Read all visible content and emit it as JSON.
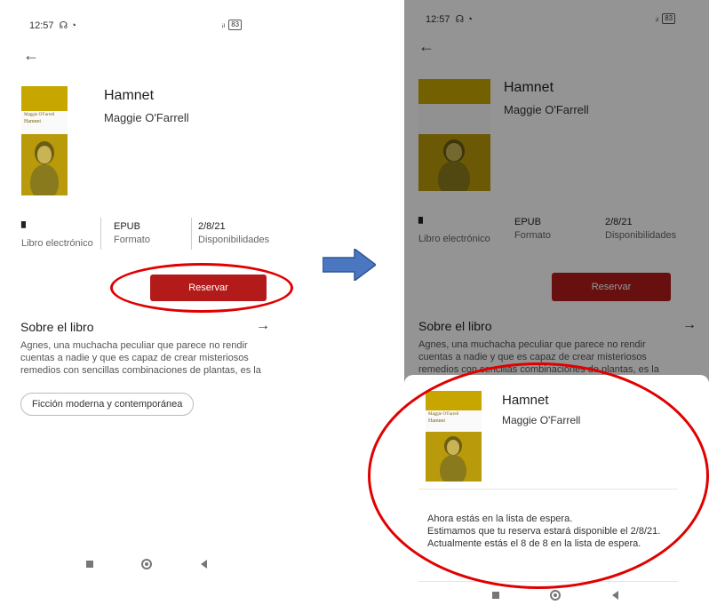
{
  "status": {
    "time": "12:57",
    "icons": "☊ ◔",
    "signal": "ᵢₗ",
    "battery": "83"
  },
  "book": {
    "title": "Hamnet",
    "author": "Maggie O'Farrell",
    "cover_author": "Maggie O'Farrell",
    "cover_title": "Hamnet"
  },
  "meta": {
    "type_label": "Libro electrónico",
    "format_value": "EPUB",
    "format_label": "Formato",
    "date_value": "2/8/21",
    "date_label": "Disponibilidades"
  },
  "actions": {
    "reserve_label": "Reservar"
  },
  "about": {
    "title": "Sobre el libro",
    "description_lines": [
      "Agnes, una muchacha peculiar que parece no rendir",
      "cuentas a nadie y que es capaz de crear misteriosos",
      "remedios con sencillas combinaciones de plantas, es la"
    ]
  },
  "genre_chip": "Ficción moderna y contemporánea",
  "waitlist": {
    "lines": [
      "Ahora estás en la lista de espera.",
      "Estimamos que tu reserva estará disponible el 2/8/21.",
      "Actualmente estás el 8 de 8 en la lista de espera."
    ]
  },
  "colors": {
    "accent": "#b31b1b",
    "annotation": "#e00000",
    "arrow": "#4a77bf",
    "cover": "#c9a80a"
  },
  "icons": {
    "back": "arrow-left-icon",
    "about": "arrow-right-icon",
    "ebook": "ebook-icon",
    "nav": [
      "recents-icon",
      "home-icon",
      "back-triangle-icon"
    ],
    "flow": "flow-arrow-icon"
  }
}
